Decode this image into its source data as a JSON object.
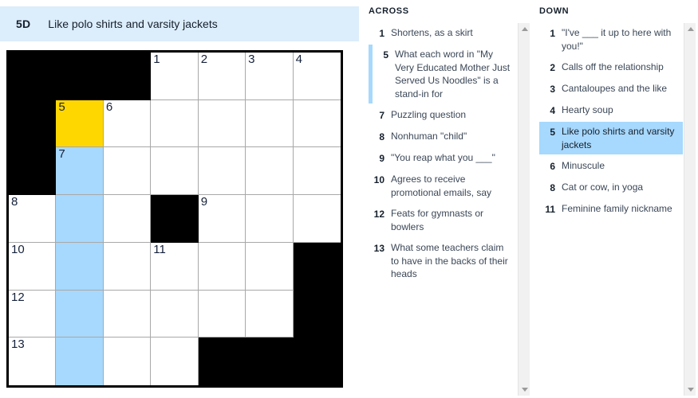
{
  "banner": {
    "clue_number": "5D",
    "clue_text": "Like polo shirts and varsity jackets"
  },
  "grid": {
    "rows": 7,
    "cols": 7,
    "colors": {
      "current_cell": "#ffd700",
      "highlight_word": "#a7d8fd",
      "block": "#000000",
      "banner_bg": "#dcedfb"
    },
    "cells": [
      [
        {
          "type": "block"
        },
        {
          "type": "block"
        },
        {
          "type": "block"
        },
        {
          "type": "open",
          "num": "1"
        },
        {
          "type": "open",
          "num": "2"
        },
        {
          "type": "open",
          "num": "3"
        },
        {
          "type": "open",
          "num": "4"
        }
      ],
      [
        {
          "type": "block"
        },
        {
          "type": "open",
          "num": "5",
          "state": "current"
        },
        {
          "type": "open",
          "num": "6"
        },
        {
          "type": "open"
        },
        {
          "type": "open"
        },
        {
          "type": "open"
        },
        {
          "type": "open"
        }
      ],
      [
        {
          "type": "block"
        },
        {
          "type": "open",
          "num": "7",
          "state": "highlight"
        },
        {
          "type": "open"
        },
        {
          "type": "open"
        },
        {
          "type": "open"
        },
        {
          "type": "open"
        },
        {
          "type": "open"
        }
      ],
      [
        {
          "type": "open",
          "num": "8"
        },
        {
          "type": "open",
          "state": "highlight"
        },
        {
          "type": "open"
        },
        {
          "type": "block"
        },
        {
          "type": "open",
          "num": "9"
        },
        {
          "type": "open"
        },
        {
          "type": "open"
        }
      ],
      [
        {
          "type": "open",
          "num": "10"
        },
        {
          "type": "open",
          "state": "highlight"
        },
        {
          "type": "open"
        },
        {
          "type": "open",
          "num": "11"
        },
        {
          "type": "open"
        },
        {
          "type": "open"
        },
        {
          "type": "block"
        }
      ],
      [
        {
          "type": "open",
          "num": "12"
        },
        {
          "type": "open",
          "state": "highlight"
        },
        {
          "type": "open"
        },
        {
          "type": "open"
        },
        {
          "type": "open"
        },
        {
          "type": "open"
        },
        {
          "type": "block"
        }
      ],
      [
        {
          "type": "open",
          "num": "13"
        },
        {
          "type": "open",
          "state": "highlight"
        },
        {
          "type": "open"
        },
        {
          "type": "open"
        },
        {
          "type": "block"
        },
        {
          "type": "block"
        },
        {
          "type": "block"
        }
      ]
    ]
  },
  "across": {
    "title": "ACROSS",
    "clues": [
      {
        "num": "1",
        "text": "Shortens, as a skirt",
        "state": "none"
      },
      {
        "num": "5",
        "text": "What each word in \"My Very Educated Mother Just Served Us Noodles\" is a stand-in for",
        "state": "bar"
      },
      {
        "num": "7",
        "text": "Puzzling question",
        "state": "none"
      },
      {
        "num": "8",
        "text": "Nonhuman \"child\"",
        "state": "none"
      },
      {
        "num": "9",
        "text": "\"You reap what you ___\"",
        "state": "none"
      },
      {
        "num": "10",
        "text": "Agrees to receive promotional emails, say",
        "state": "none"
      },
      {
        "num": "12",
        "text": "Feats for gymnasts or bowlers",
        "state": "none"
      },
      {
        "num": "13",
        "text": "What some teachers claim to have in the backs of their heads",
        "state": "none"
      }
    ]
  },
  "down": {
    "title": "DOWN",
    "clues": [
      {
        "num": "1",
        "text": "\"I've ___ it up to here with you!\"",
        "state": "none"
      },
      {
        "num": "2",
        "text": "Calls off the relationship",
        "state": "none"
      },
      {
        "num": "3",
        "text": "Cantaloupes and the like",
        "state": "none"
      },
      {
        "num": "4",
        "text": "Hearty soup",
        "state": "none"
      },
      {
        "num": "5",
        "text": "Like polo shirts and varsity jackets",
        "state": "full"
      },
      {
        "num": "6",
        "text": "Minuscule",
        "state": "none"
      },
      {
        "num": "8",
        "text": "Cat or cow, in yoga",
        "state": "none"
      },
      {
        "num": "11",
        "text": "Feminine family nickname",
        "state": "none"
      }
    ]
  },
  "scrollbars": {
    "across": {
      "thumb_top_pct": 0,
      "thumb_height_pct": 100
    },
    "down": {
      "thumb_top_pct": 0,
      "thumb_height_pct": 100
    }
  }
}
